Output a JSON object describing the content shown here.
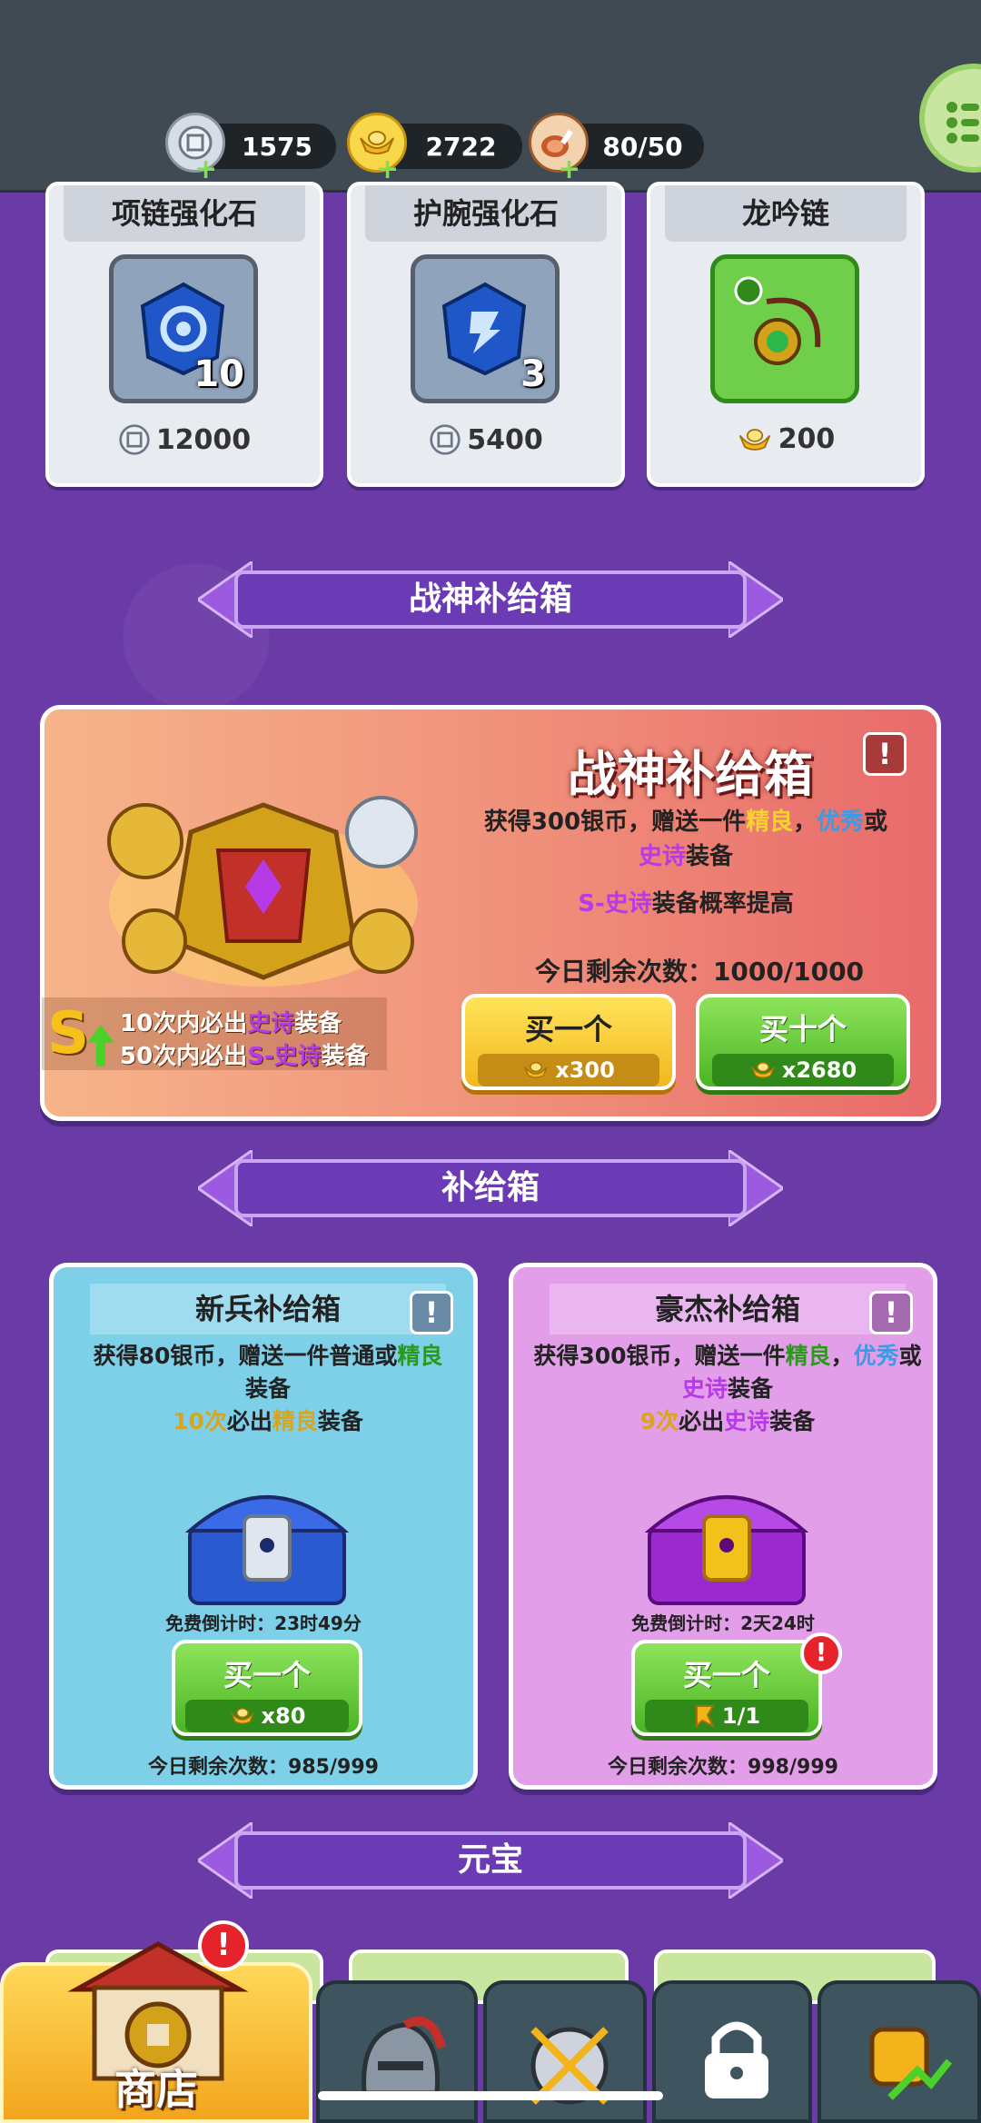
{
  "resources": {
    "silver": "1575",
    "gold": "2722",
    "stamina": "80/50"
  },
  "items": [
    {
      "name": "项链强化石",
      "count": "10",
      "price": "12000",
      "currency": "silver-coin-icon",
      "icon": "blue-gem-icon"
    },
    {
      "name": "护腕强化石",
      "count": "3",
      "price": "5400",
      "currency": "silver-coin-icon",
      "icon": "blue-gem-icon"
    },
    {
      "name": "龙吟链",
      "count": "",
      "price": "200",
      "currency": "gold-ingot-icon",
      "icon": "necklace-icon"
    }
  ],
  "sections": {
    "war_god": "战神补给箱",
    "supply": "补给箱",
    "ingot": "元宝"
  },
  "war_box": {
    "title": "战神补给箱",
    "desc_1": "获得300银币，赠送一件",
    "desc_fine": "精良",
    "desc_sep": "，",
    "desc_excellent": "优秀",
    "desc_or": "或",
    "desc_epic": "史诗",
    "desc_end": "装备",
    "prob_s_epic": "S-史诗",
    "prob_rest": "装备概率提高",
    "remaining": "今日剩余次数：1000/1000",
    "g1_pre": "10次内必出",
    "g1_hl": "史诗",
    "g1_post": "装备",
    "g2_pre": "50次内必出",
    "g2_hl": "S-史诗",
    "g2_post": "装备",
    "buy_one": "买一个",
    "buy_one_cost": "x300",
    "buy_ten": "买十个",
    "buy_ten_cost": "x2680",
    "warn": "!"
  },
  "recruit_box": {
    "title": "新兵补给箱",
    "desc_1": "获得80银币，赠送一件普通或",
    "desc_fine": "精良",
    "desc_end": "装备",
    "guar_count": "10次",
    "guar_mid": "必出",
    "guar_hl": "精良",
    "guar_post": "装备",
    "timer": "免费倒计时：23时49分",
    "buy": "买一个",
    "cost": "x80",
    "remaining": "今日剩余次数：985/999"
  },
  "hero_box": {
    "title": "豪杰补给箱",
    "desc_1": "获得300银币，赠送一件",
    "desc_fine": "精良",
    "desc_sep": "，",
    "desc_excellent": "优秀",
    "desc_or": "或",
    "desc_epic": "史诗",
    "desc_end": "装备",
    "guar_count": "9次",
    "guar_mid": "必出",
    "guar_hl": "史诗",
    "guar_post": "装备",
    "timer": "免费倒计时：2天24时",
    "buy": "买一个",
    "cost": "1/1",
    "remaining": "今日剩余次数：998/999"
  },
  "nav": {
    "shop": "商店",
    "badge": "!"
  },
  "colors": {
    "background": "#6a3aa6",
    "accent_yellow": "#f6d32a",
    "accent_blue": "#3a9be6",
    "accent_purple": "#b63ae6",
    "accent_green": "#4bb524"
  }
}
